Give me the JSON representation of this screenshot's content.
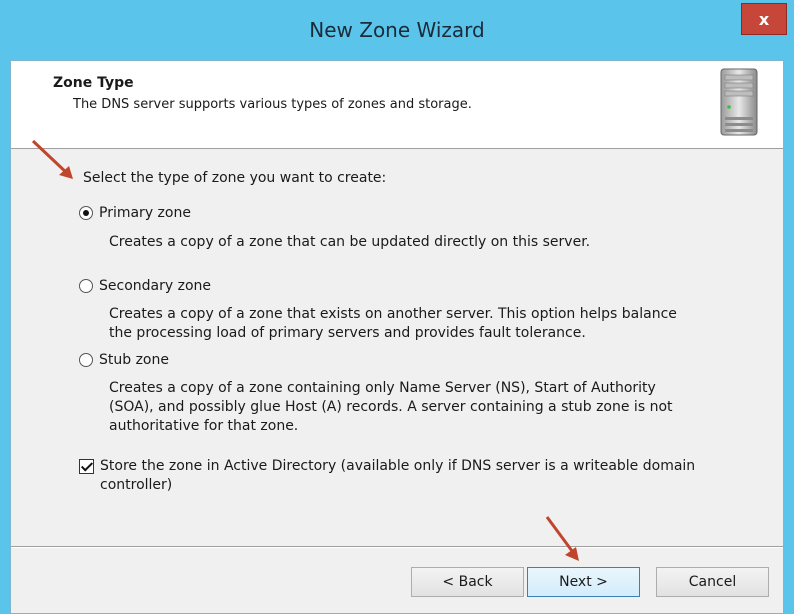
{
  "window": {
    "title": "New Zone Wizard",
    "close_label": "x"
  },
  "header": {
    "title": "Zone Type",
    "description": "The DNS server supports various types of zones and storage.",
    "icon": "server-icon"
  },
  "content": {
    "prompt": "Select the type of zone you want to create:",
    "options": [
      {
        "label": "Primary zone",
        "selected": true,
        "description": "Creates a copy of a zone that can be updated directly on this server."
      },
      {
        "label": "Secondary zone",
        "selected": false,
        "description_lines": [
          "Creates a copy of a zone that exists on another server. This option helps balance",
          "the processing load of primary servers and provides fault tolerance."
        ]
      },
      {
        "label": "Stub zone",
        "selected": false,
        "description_lines": [
          "Creates a copy of a zone containing only Name Server (NS), Start of Authority",
          "(SOA), and possibly glue Host (A) records. A server containing a stub zone is not",
          "authoritative for that zone."
        ]
      }
    ],
    "store_ad": {
      "checked": true,
      "label_lines": [
        "Store the zone in Active Directory (available only if DNS server is a writeable domain",
        "controller)"
      ]
    }
  },
  "buttons": {
    "back": "< Back",
    "next": "Next >",
    "cancel": "Cancel"
  },
  "colors": {
    "titlebar": "#5bc4ea",
    "close": "#c7463a",
    "annotation_arrow": "#c0452a"
  }
}
